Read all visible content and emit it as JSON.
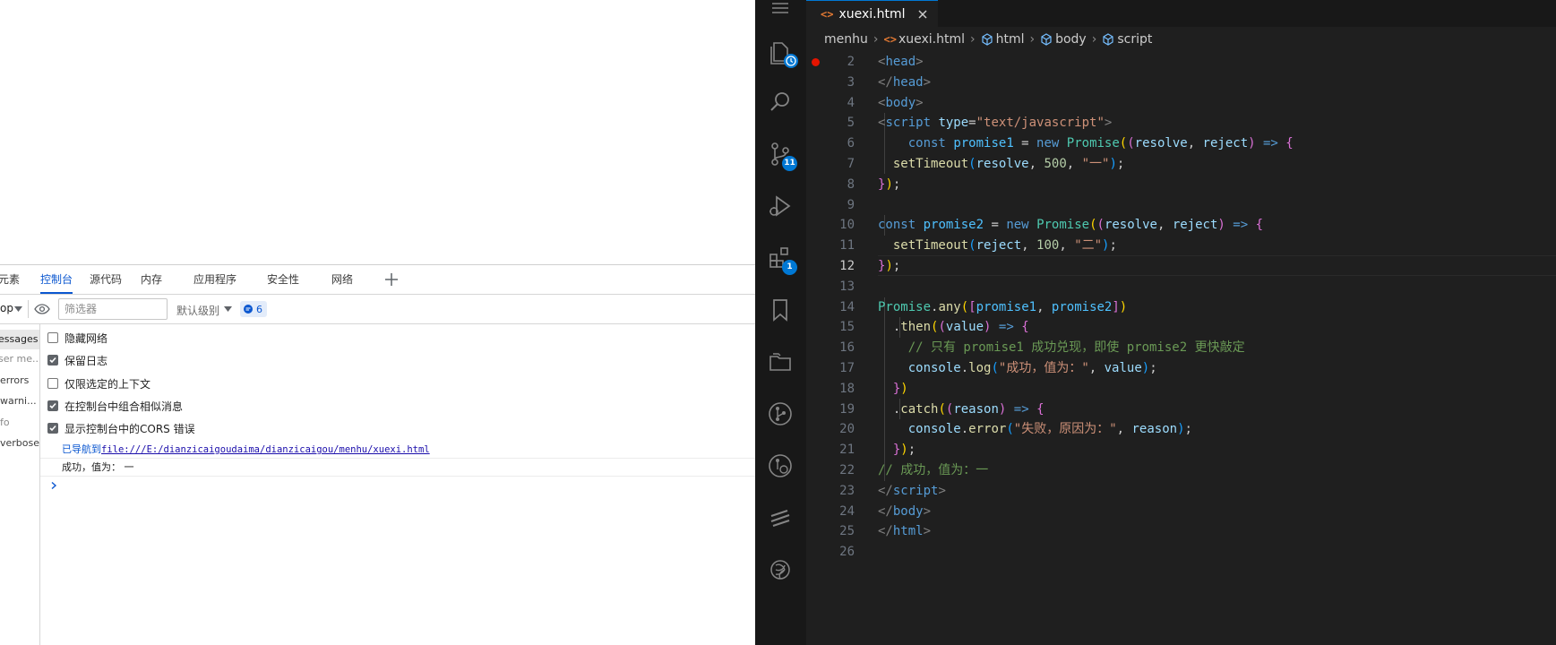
{
  "devtools": {
    "tabs": [
      "元素",
      "控制台",
      "源代码",
      "内存",
      "应用程序",
      "安全性",
      "网络"
    ],
    "active_tab": "控制台",
    "toolbar": {
      "context": "op",
      "filter_placeholder": "筛选器",
      "level": "默认级别",
      "issues_count": "6"
    },
    "sidebar": [
      "essages",
      "ser me...",
      "errors",
      "warni...",
      "fo",
      "verbose"
    ],
    "settings": [
      {
        "label": "隐藏网络",
        "checked": false
      },
      {
        "label": "保留日志",
        "checked": true
      },
      {
        "label": "仅限选定的上下文",
        "checked": false
      },
      {
        "label": "在控制台中组合相似消息",
        "checked": true
      },
      {
        "label": "显示控制台中的CORS 错误",
        "checked": true
      }
    ],
    "log": {
      "navigated_prefix": "已导航到",
      "navigated_url": "file:///E:/dianzicaigoudaima/dianzicaigou/menhu/xuexi.html",
      "output": "成功，值为： 一"
    }
  },
  "vscode": {
    "tab_title": "xuexi.html",
    "tab_icon": "<>",
    "breadcrumb": [
      "menhu",
      "xuexi.html",
      "html",
      "body",
      "script"
    ],
    "badges": {
      "source_control": "11",
      "extensions": "1"
    },
    "active_line": "12",
    "line_numbers": [
      "2",
      "3",
      "4",
      "5",
      "6",
      "7",
      "8",
      "9",
      "10",
      "11",
      "12",
      "13",
      "14",
      "15",
      "16",
      "17",
      "18",
      "19",
      "20",
      "21",
      "22",
      "23",
      "24",
      "25",
      "26"
    ],
    "code": {
      "l2": [
        "<",
        "head",
        ">"
      ],
      "l3": [
        "</",
        "head",
        ">"
      ],
      "l4": [
        "<",
        "body",
        ">"
      ],
      "l5": [
        "<",
        "script",
        " ",
        "type",
        "=",
        "\"text/javascript\"",
        ">"
      ],
      "l6": [
        "    ",
        "const",
        " ",
        "promise1",
        " = ",
        "new",
        " ",
        "Promise",
        "(",
        "(",
        "resolve",
        ", ",
        "reject",
        ")",
        " => ",
        "{"
      ],
      "l7": [
        "  ",
        "setTimeout",
        "(",
        "resolve",
        ", ",
        "500",
        ", ",
        "\"一\"",
        ")",
        ";"
      ],
      "l8": [
        "}",
        ")",
        ";"
      ],
      "l10": [
        "const",
        " ",
        "promise2",
        " = ",
        "new",
        " ",
        "Promise",
        "(",
        "(",
        "resolve",
        ", ",
        "reject",
        ")",
        " => ",
        "{"
      ],
      "l11": [
        "  ",
        "setTimeout",
        "(",
        "reject",
        ", ",
        "100",
        ", ",
        "\"二\"",
        ")",
        ";"
      ],
      "l12": [
        "}",
        ")",
        ";"
      ],
      "l14": [
        "Promise",
        ".",
        "any",
        "(",
        "[",
        "promise1",
        ", ",
        "promise2",
        "]",
        ")"
      ],
      "l15": [
        "  .",
        "then",
        "(",
        "(",
        "value",
        ")",
        " => ",
        "{"
      ],
      "l16": [
        "    ",
        "// 只有 promise1 成功兑现，即使 promise2 更快敲定"
      ],
      "l17": [
        "    ",
        "console",
        ".",
        "log",
        "(",
        "\"成功，值为：\"",
        ", ",
        "value",
        ")",
        ";"
      ],
      "l18": [
        "  ",
        "}",
        ")"
      ],
      "l19": [
        "  .",
        "catch",
        "(",
        "(",
        "reason",
        ")",
        " => ",
        "{"
      ],
      "l20": [
        "    ",
        "console",
        ".",
        "error",
        "(",
        "\"失败，原因为：\"",
        ", ",
        "reason",
        ")",
        ";"
      ],
      "l21": [
        "  ",
        "}",
        ")",
        ";"
      ],
      "l22": [
        "// 成功，值为：一"
      ],
      "l23": [
        "</",
        "script",
        ">"
      ],
      "l24": [
        "</",
        "body",
        ">"
      ],
      "l25": [
        "</",
        "html",
        ">"
      ]
    },
    "colors": {
      "accent": "#0078d4",
      "breakpoint": "#e51400",
      "keyword": "#569cd6",
      "string": "#ce9178",
      "comment": "#6a9955",
      "function": "#dcdcaa",
      "class": "#4ec9b0"
    }
  }
}
